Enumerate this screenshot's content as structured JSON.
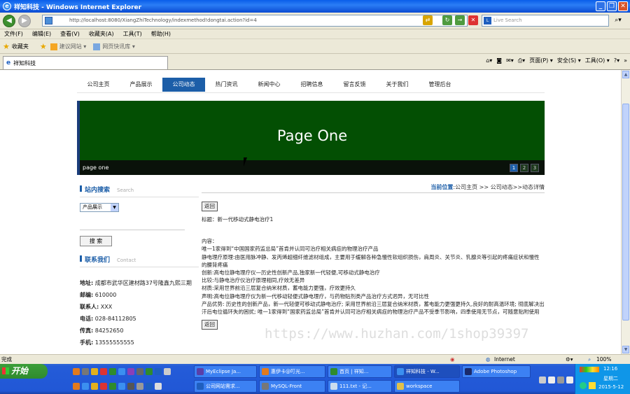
{
  "window": {
    "title": "祥知科技 - Windows Internet Explorer"
  },
  "browser": {
    "address": "http://localhost:8080/XiangZhiTechnology/indexmethod!dongtai.action?id=4",
    "search_placeholder": "Live Search",
    "menu": [
      "文件(F)",
      "编辑(E)",
      "查看(V)",
      "收藏夹(A)",
      "工具(T)",
      "帮助(H)"
    ],
    "favorites_label": "收藏夹",
    "fav_links": [
      "建议网站 ▾",
      "网页快讯库 ▾"
    ],
    "tab_label": "祥知科技",
    "commands": [
      "页面(P) ▾",
      "安全(S) ▾",
      "工具(O) ▾"
    ]
  },
  "site": {
    "nav": [
      "公司主页",
      "产品展示",
      "公司动态",
      "热门资讯",
      "新闻中心",
      "招聘信息",
      "留言反馈",
      "关于我们",
      "管理后台"
    ],
    "active_nav": 2,
    "banner": {
      "title": "Page One",
      "caption": "page one",
      "pages": [
        "1",
        "2",
        "3"
      ]
    },
    "search": {
      "title": "站内搜索",
      "sub": "Search",
      "select_value": "产品展示",
      "button": "搜 索"
    },
    "contact": {
      "title": "联系我们",
      "sub": "Contact",
      "address_label": "地址:",
      "address": "成都市武华区建材路37号隆鑫九熙三期",
      "zip_label": "邮编:",
      "zip": "610000",
      "person_label": "联系人:",
      "person": "XXX",
      "phone_label": "电话:",
      "phone": "028-84112805",
      "fax_label": "传真:",
      "fax": "84252650",
      "mobile_label": "手机:",
      "mobile": "13555555555"
    },
    "breadcrumb": {
      "label": "当前位置",
      "path": ":公司主页 >> 公司动态>>动态详情"
    },
    "article": {
      "back_button": "返回",
      "title_line": "标题：新一代移动式静电治疗1",
      "content_label": "内容：",
      "paragraphs": [
        "唯一1家得到“中国国家药监总局”首肯并认同可治疗相关病症的物理治疗产品",
        "静电理疗原理:由医用脉冲静、发丙烯超细纤维滤材组成，主要用于缓解各种急慢性软组织损伤，肩周炎、关节炎、乳腺炎等引起的疼痛症状和慢性的腰背疼痛",
        "创新:高电位静电理疗仪—历史性创新产品,独家新一代轻便,可移动式静电治疗",
        "比较:与静电治疗仪治疗原理相同,疗效无差异",
        "材质:采用世界前沿三层复合纳米材质，蓄电能力更强，疗效更持久",
        "声明:高电位静电理疗仪为新一代移动轻便式静电理疗，与药物贴剂类产品治疗方式迥异，无可比性",
        "产品优势: 历史性的创新产品，新一代轻便可移动式静电治疗; 采用世界前沿三层复合纳米材质，蓄电能力更强更持久,良好的耐高温环境; 彻底解决出汗后电位循环失的困扰; 唯一1家得到“国家药监总局”首肯并认同可治疗相关病症的物理治疗产品不受季节影响，四季使用无节点，可随意贴附使用"
      ]
    }
  },
  "watermark": "https://www.huzhan.com/1shop39397",
  "status": {
    "left": "完成",
    "zone": "Internet",
    "zoom": "100%"
  },
  "taskbar": {
    "start": "开始",
    "tasks_row1": [
      "MyEclipse Ja...",
      "惠伊卡@叮光...",
      "首页 | 祥知...",
      "祥知科技 - W...",
      "Adobe Photoshop"
    ],
    "tasks_row2": [
      "公司网站需求...",
      "MySQL-Front",
      "111.txt - 记...",
      "workspace"
    ],
    "clock": {
      "time": "12:16",
      "weekday": "星期二",
      "date": "2015-5-12"
    }
  }
}
